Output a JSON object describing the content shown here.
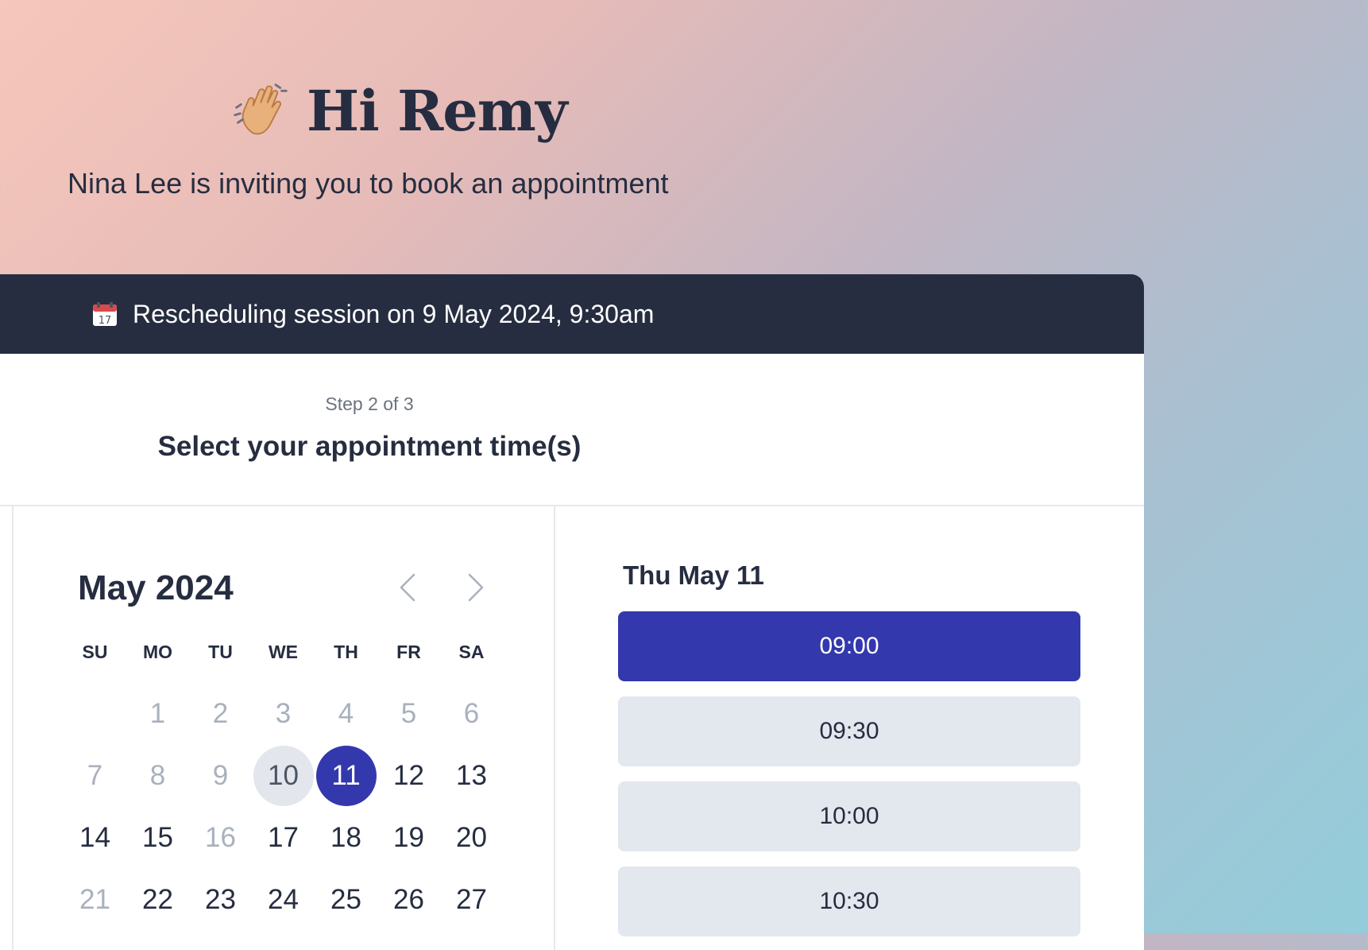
{
  "header": {
    "greeting": "Hi Remy",
    "greeting_icon": "waving-hand-icon",
    "subtitle": "Nina Lee is inviting you to book an appointment"
  },
  "banner": {
    "icon": "calendar-icon",
    "text": "Rescheduling session on 9 May 2024, 9:30am"
  },
  "step": {
    "label": "Step 2 of 3",
    "title": "Select your appointment time(s)"
  },
  "calendar": {
    "month_title": "May 2024",
    "weekdays": [
      "SU",
      "MO",
      "TU",
      "WE",
      "TH",
      "FR",
      "SA"
    ],
    "days": [
      {
        "label": "",
        "state": "empty"
      },
      {
        "label": "1",
        "state": "muted"
      },
      {
        "label": "2",
        "state": "muted"
      },
      {
        "label": "3",
        "state": "muted"
      },
      {
        "label": "4",
        "state": "muted"
      },
      {
        "label": "5",
        "state": "muted"
      },
      {
        "label": "6",
        "state": "muted"
      },
      {
        "label": "7",
        "state": "muted"
      },
      {
        "label": "8",
        "state": "muted"
      },
      {
        "label": "9",
        "state": "muted"
      },
      {
        "label": "10",
        "state": "today"
      },
      {
        "label": "11",
        "state": "selected"
      },
      {
        "label": "12",
        "state": "available"
      },
      {
        "label": "13",
        "state": "available"
      },
      {
        "label": "14",
        "state": "available"
      },
      {
        "label": "15",
        "state": "available"
      },
      {
        "label": "16",
        "state": "muted"
      },
      {
        "label": "17",
        "state": "available"
      },
      {
        "label": "18",
        "state": "available"
      },
      {
        "label": "19",
        "state": "available"
      },
      {
        "label": "20",
        "state": "available"
      },
      {
        "label": "21",
        "state": "muted"
      },
      {
        "label": "22",
        "state": "available"
      },
      {
        "label": "23",
        "state": "available"
      },
      {
        "label": "24",
        "state": "available"
      },
      {
        "label": "25",
        "state": "available"
      },
      {
        "label": "26",
        "state": "available"
      },
      {
        "label": "27",
        "state": "available"
      }
    ]
  },
  "slots": {
    "date_label": "Thu May 11",
    "times": [
      {
        "label": "09:00",
        "active": true
      },
      {
        "label": "09:30",
        "active": false
      },
      {
        "label": "10:00",
        "active": false
      },
      {
        "label": "10:30",
        "active": false
      }
    ]
  },
  "colors": {
    "accent": "#3438ad",
    "dark": "#262d40",
    "slot_bg": "#e3e7ee",
    "today_bg": "#e3e6ec",
    "muted_text": "#a9b1bd"
  }
}
